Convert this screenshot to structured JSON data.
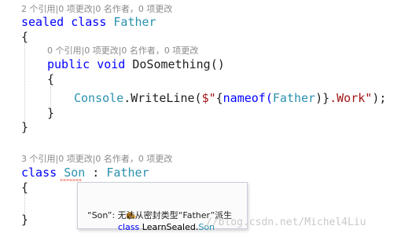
{
  "codelens": {
    "father_class": "2 个引用|0 项更改|0 名作者，0 项更改",
    "do_something": "0 个引用|0 项更改|0 名作者，0 项更改",
    "son_class": "3 个引用|0 项更改|0 名作者，0 项更改"
  },
  "code": {
    "sealed_kw": "sealed",
    "class_kw": "class",
    "father_name": "Father",
    "open_brace": "{",
    "close_brace": "}",
    "public_kw": "public",
    "void_kw": "void",
    "method_name": "DoSomething",
    "parens": "()",
    "console_type": "Console",
    "writeline_call": ".WriteLine(",
    "string_prefix": "$\"",
    "interp_open": "{",
    "nameof_call": "nameof(",
    "nameof_arg": "Father",
    "interp_close": ")}",
    "string_rest": ".Work\"",
    "stmt_end": ");",
    "son_name": "Son",
    "colon": " : ",
    "base_name": "Father"
  },
  "tooltip": {
    "class_kw": "class",
    "namespace": "LearnSealed.",
    "type_name": "Son",
    "error_message": "“Son”: 无法从密封类型“Father”派生"
  },
  "watermark": "//blog.csdn.net/Michel4Liu",
  "colors": {
    "keyword": "#0000ff",
    "type": "#2b91af",
    "error_squiggle": "#e51400"
  },
  "icons": {
    "tooltip": "class-icon"
  }
}
